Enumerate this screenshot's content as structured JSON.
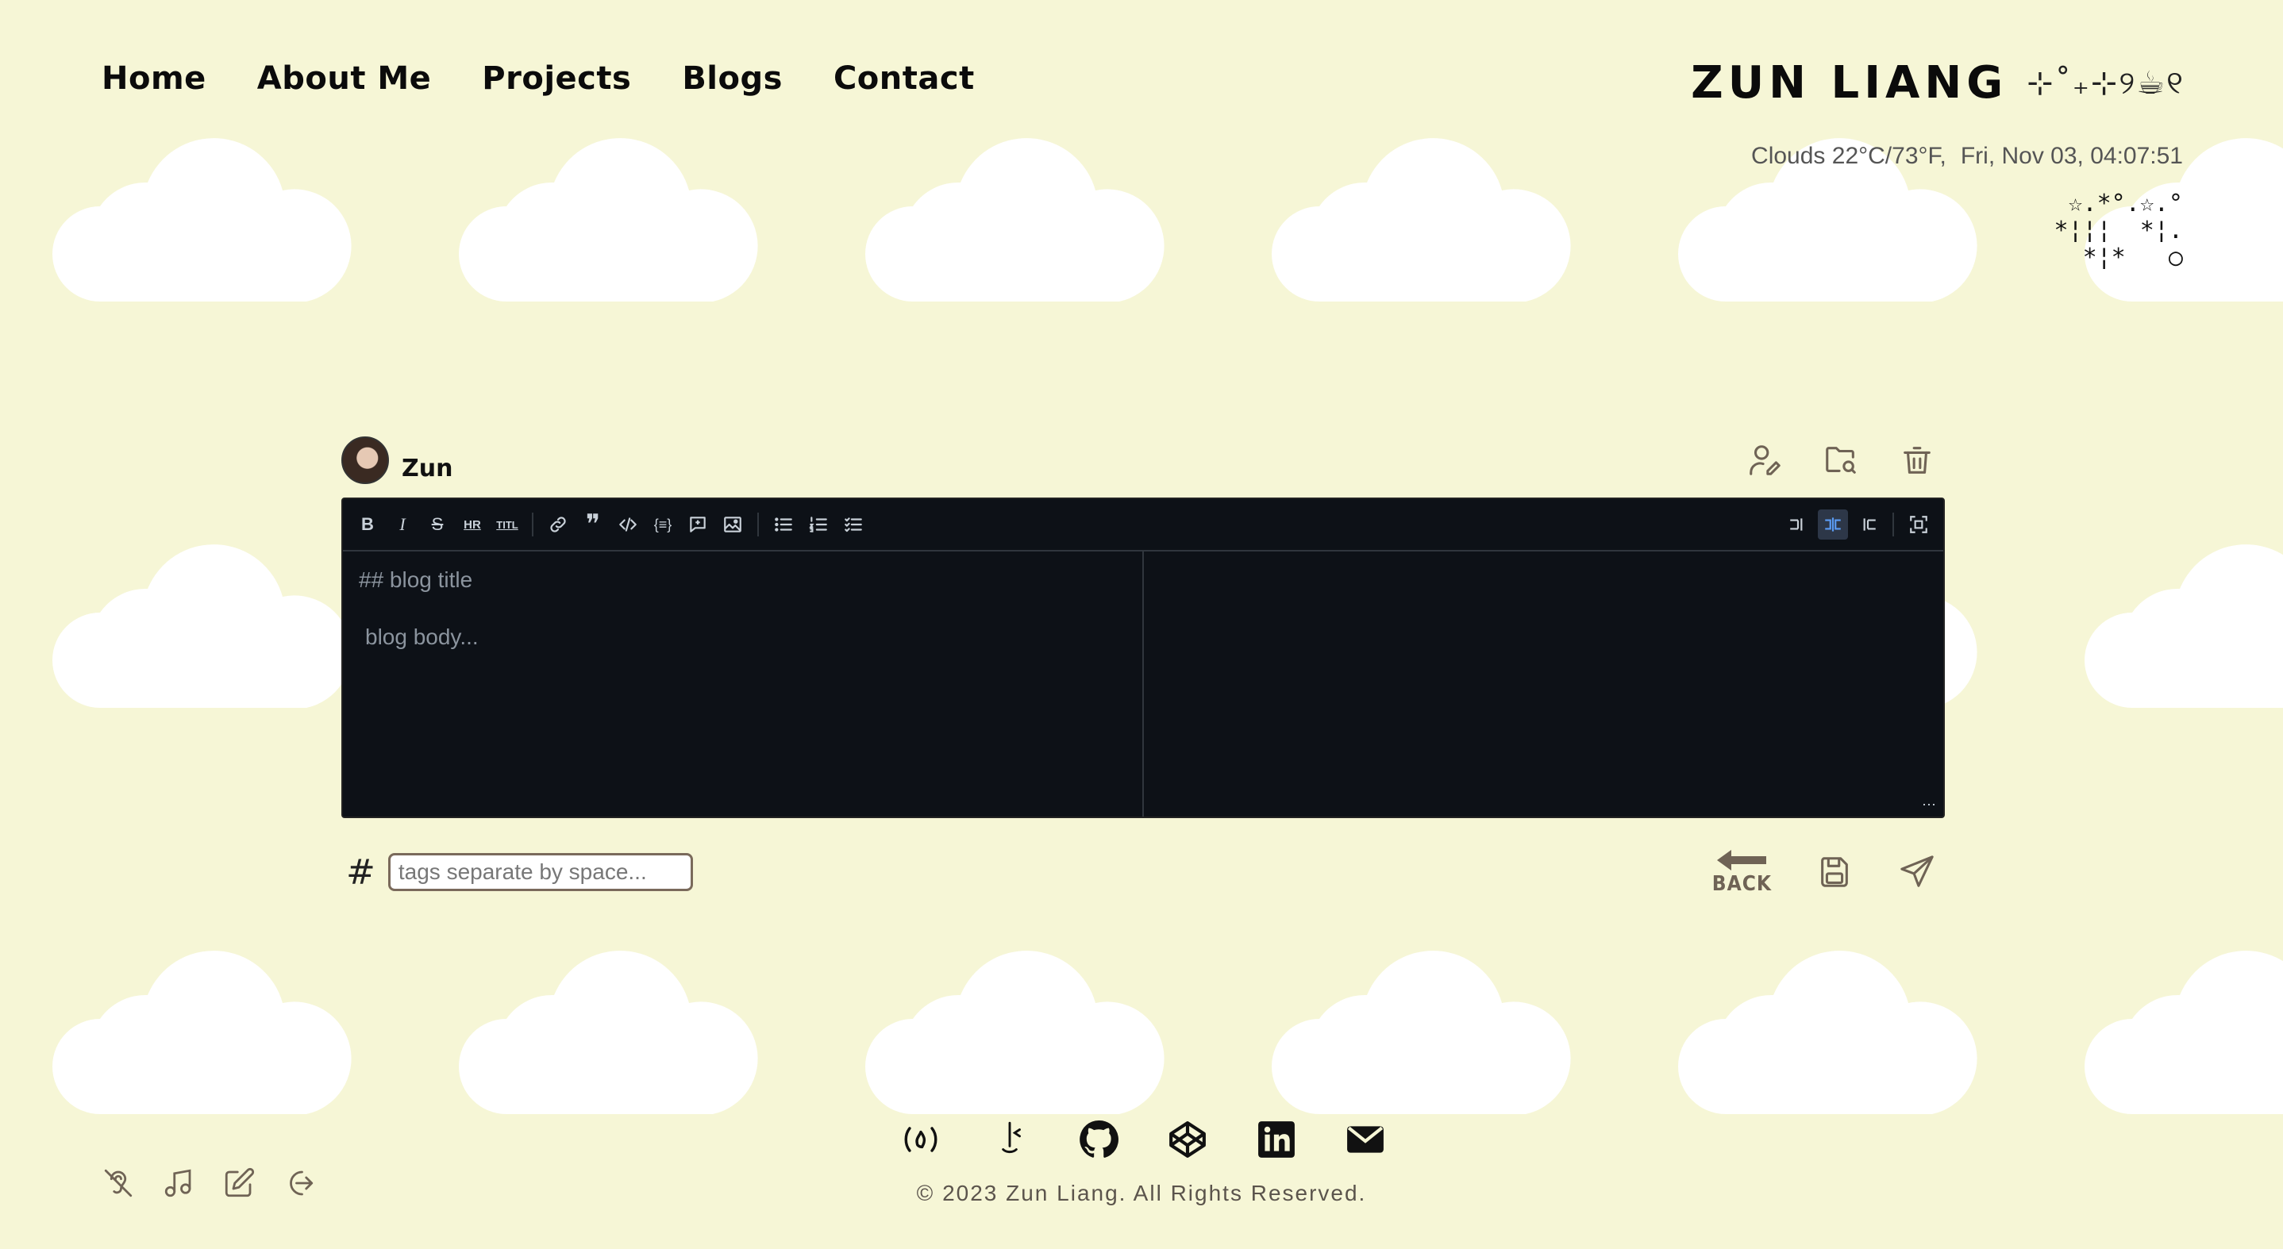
{
  "nav": {
    "items": [
      "Home",
      "About Me",
      "Projects",
      "Blogs",
      "Contact"
    ]
  },
  "brand": {
    "name": "ZUN LIANG",
    "decoration": "⊹˚₊⊹୨☕୧"
  },
  "weather": {
    "text": "Clouds 22°C/73°F,",
    "datetime": "Fri, Nov 03, 04:07:51"
  },
  "stars_art": "☆.*°.☆.°\n*¦¦¦  *¦.\n*¦*   ○",
  "editor": {
    "user_name": "Zun",
    "title_placeholder": "## blog title",
    "body_placeholder": "blog body...",
    "toolbar": {
      "left": [
        "bold",
        "italic",
        "strikethrough",
        "hr",
        "title",
        "link",
        "quote",
        "code",
        "code-block",
        "comment",
        "image",
        "unordered-list",
        "ordered-list",
        "checked-list"
      ],
      "right": [
        "edit-only",
        "live-preview",
        "preview-only",
        "fullscreen"
      ],
      "active": "live-preview"
    },
    "resize_handle": "⋯"
  },
  "tags": {
    "hash": "#",
    "placeholder": "tags separate by space..."
  },
  "actions": {
    "back_label": "BACK"
  },
  "footer": {
    "copyright": "© 2023 Zun Liang. All Rights Reserved.",
    "socials": [
      "freecodecamp",
      "leetcode",
      "github",
      "codepen",
      "linkedin",
      "email"
    ]
  },
  "colors": {
    "background": "#f6f6d6",
    "editor_bg": "#0d1117",
    "icon_brown": "#6f6355",
    "active_tool": "#5b9cf5"
  }
}
